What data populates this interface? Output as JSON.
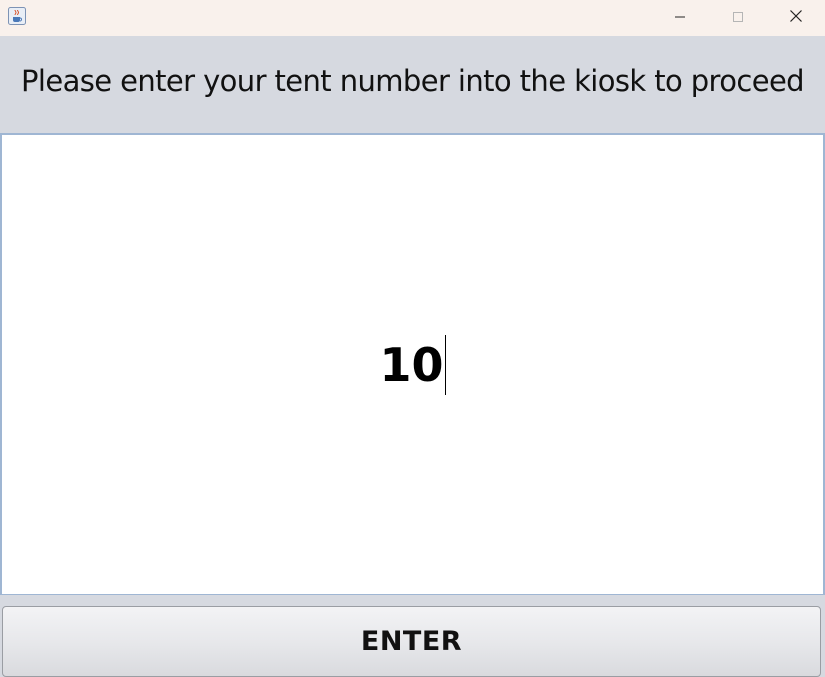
{
  "titlebar": {
    "app_icon": "java-cup-icon",
    "controls": {
      "minimize_icon": "minimize-icon",
      "maximize_icon": "maximize-icon",
      "close_icon": "close-icon"
    }
  },
  "header": {
    "prompt": "Please enter your tent number into the kiosk to proceed"
  },
  "entry": {
    "value": "10"
  },
  "actions": {
    "enter_label": "ENTER"
  },
  "colors": {
    "titlebar_bg": "#f9f1ec",
    "panel_bg": "#d6d9e0",
    "entry_border": "#9fb6d3",
    "entry_bg": "#ffffff"
  }
}
